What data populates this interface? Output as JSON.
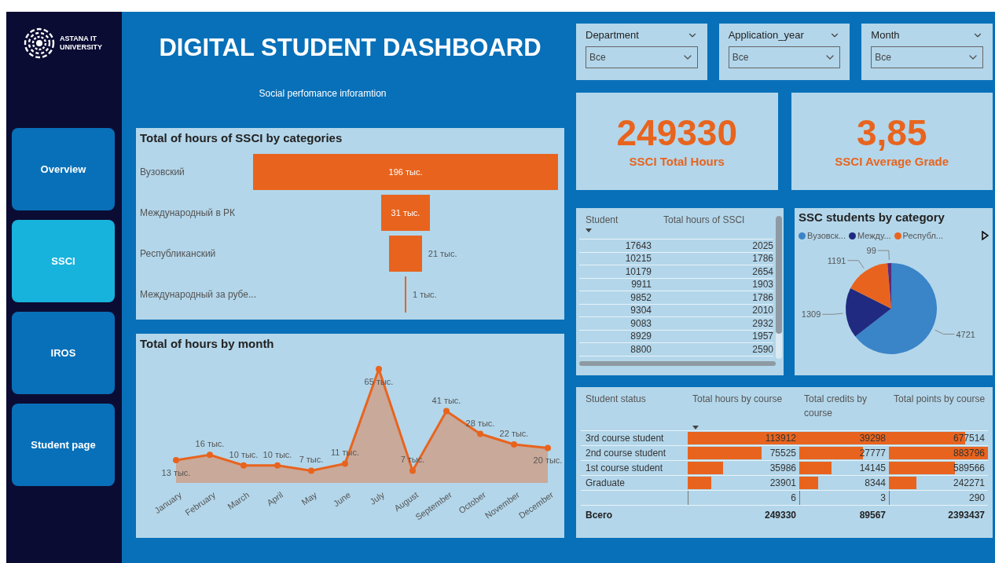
{
  "sidebar": {
    "logo_lines": [
      "ASTANA IT",
      "UNIVERSITY"
    ],
    "items": [
      {
        "label": "Overview",
        "selected": false
      },
      {
        "label": "SSCI",
        "selected": true
      },
      {
        "label": "IROS",
        "selected": false
      },
      {
        "label": "Student page",
        "selected": false
      }
    ]
  },
  "header": {
    "title": "DIGITAL STUDENT DASHBOARD",
    "subtitle": "Social perfomance inforamtion"
  },
  "filters": [
    {
      "label": "Department",
      "value": "Все"
    },
    {
      "label": "Application_year",
      "value": "Все"
    },
    {
      "label": "Month",
      "value": "Все"
    }
  ],
  "kpis": [
    {
      "value": "249330",
      "label": "SSCI Total Hours"
    },
    {
      "value": "3,85",
      "label": "SSCI Average Grade"
    }
  ],
  "categories_chart": {
    "title": "Total of hours of SSCI by categories",
    "bars": [
      {
        "label": "Вузовский",
        "value_label": "196 тыс."
      },
      {
        "label": "Международный в РК",
        "value_label": "31 тыс."
      },
      {
        "label": "Республиканский",
        "value_label": "21 тыс."
      },
      {
        "label": "Международный за рубе...",
        "value_label": "1 тыс."
      }
    ]
  },
  "month_chart": {
    "chart_data": {
      "type": "area",
      "title": "Total of hours by month",
      "categories": [
        "January",
        "February",
        "March",
        "April",
        "May",
        "June",
        "July",
        "August",
        "September",
        "October",
        "November",
        "December"
      ],
      "values": [
        13,
        16,
        10,
        10,
        7,
        11,
        65,
        7,
        41,
        28,
        22,
        20
      ],
      "value_labels": [
        "13 тыс.",
        "16 тыс.",
        "10 тыс.",
        "10 тыс.",
        "7 тыс.",
        "11 тыс.",
        "65 тыс.",
        "7 тыс.",
        "41 тыс.",
        "28 тыс.",
        "22 тыс.",
        "20 тыс."
      ]
    }
  },
  "student_table": {
    "columns": [
      "Student",
      "Total hours of SSCI"
    ],
    "rows": [
      [
        "17643",
        "2025"
      ],
      [
        "10215",
        "1786"
      ],
      [
        "10179",
        "2654"
      ],
      [
        "9911",
        "1903"
      ],
      [
        "9852",
        "1786"
      ],
      [
        "9304",
        "2010"
      ],
      [
        "9083",
        "2932"
      ],
      [
        "8929",
        "1957"
      ],
      [
        "8800",
        "2590"
      ]
    ]
  },
  "pie_chart": {
    "legend": [
      {
        "label": "Вузовск...",
        "color": "#3a84c8"
      },
      {
        "label": "Между...",
        "color": "#1f2a80"
      },
      {
        "label": "Республ...",
        "color": "#e8641e"
      }
    ],
    "chart_data": {
      "type": "pie",
      "title": "SSC students by category",
      "values": [
        4721,
        1309,
        1191,
        99
      ],
      "colors": [
        "#3a84c8",
        "#1f2a80",
        "#e8641e",
        "#5b2a7a"
      ],
      "value_labels": [
        "4721",
        "1309",
        "1191",
        "99"
      ]
    }
  },
  "matrix": {
    "columns": [
      "Student status",
      "Total hours by course",
      "Total credits by course",
      "Total points by course"
    ],
    "rows": [
      {
        "status": "3rd course student",
        "cells": [
          "113912",
          "39298",
          "677514"
        ]
      },
      {
        "status": "2nd course student",
        "cells": [
          "75525",
          "27777",
          "883796"
        ]
      },
      {
        "status": "1st course student",
        "cells": [
          "35986",
          "14145",
          "589566"
        ]
      },
      {
        "status": "Graduate",
        "cells": [
          "23901",
          "8344",
          "242271"
        ]
      },
      {
        "cells": [
          "6",
          "3",
          "290"
        ]
      }
    ],
    "total": {
      "label": "Всего",
      "values": [
        "249330",
        "89567",
        "2393437"
      ]
    }
  }
}
